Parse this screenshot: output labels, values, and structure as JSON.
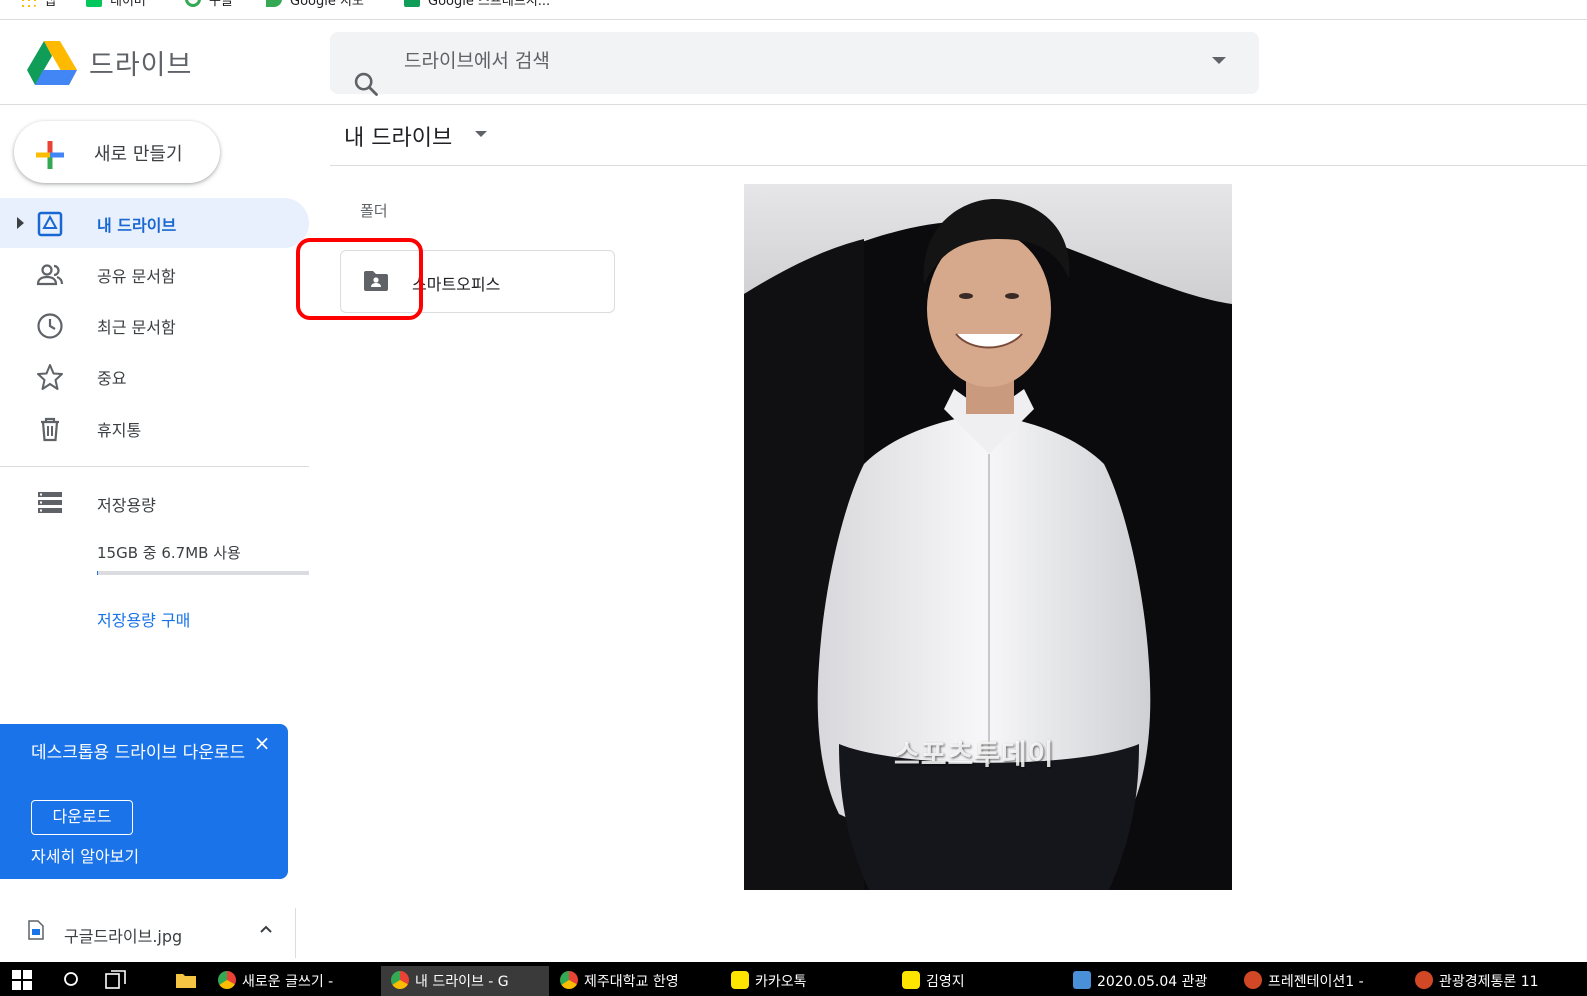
{
  "bookmarks": [
    {
      "label": "앱",
      "color": "#fbbc04"
    },
    {
      "label": "네이버",
      "color": "#03c75a"
    },
    {
      "label": "구글",
      "color": "#34a853"
    },
    {
      "label": "Google 지도",
      "color": "#34a853"
    },
    {
      "label": "Google 스프레드시...",
      "color": "#0f9d58"
    }
  ],
  "header": {
    "app_title": "드라이브",
    "search_placeholder": "드라이브에서 검색"
  },
  "new_button": {
    "label": "새로 만들기"
  },
  "sidebar": {
    "items": [
      {
        "label": "내 드라이브",
        "icon": "my-drive-icon",
        "active": true
      },
      {
        "label": "공유 문서함",
        "icon": "shared-people-icon"
      },
      {
        "label": "최근 문서함",
        "icon": "clock-icon"
      },
      {
        "label": "중요",
        "icon": "star-icon"
      },
      {
        "label": "휴지통",
        "icon": "trash-icon"
      }
    ],
    "storage": {
      "label": "저장용량",
      "usage": "15GB 중 6.7MB 사용",
      "used_fraction": 0.0005,
      "buy_label": "저장용량 구매"
    }
  },
  "main": {
    "breadcrumb": "내 드라이브",
    "folders_heading": "폴더",
    "folders": [
      {
        "name": "스마트오피스"
      }
    ]
  },
  "photo": {
    "watermark": "스포츠투데이"
  },
  "promo": {
    "title": "데스크톱용 드라이브 다운로드",
    "download_label": "다운로드",
    "learn_more": "자세히 알아보기",
    "close": "×"
  },
  "downloads": {
    "file_name": "구글드라이브.jpg"
  },
  "taskbar": {
    "items": [
      {
        "label": "새로운 글쓰기 -",
        "icon": "chrome-icon"
      },
      {
        "label": "내 드라이브 - G",
        "icon": "chrome-icon",
        "active": true
      },
      {
        "label": "제주대학교 한영",
        "icon": "chrome-icon"
      },
      {
        "label": "카카오톡",
        "icon": "kakaotalk-icon"
      },
      {
        "label": "김영지",
        "icon": "kakaotalk-icon"
      },
      {
        "label": "2020.05.04 관광",
        "icon": "document-icon"
      },
      {
        "label": "프레젠테이션1 -",
        "icon": "powerpoint-icon"
      },
      {
        "label": "관광경제통론 11",
        "icon": "powerpoint-icon"
      }
    ]
  },
  "colors": {
    "accent": "#1a73e8",
    "active_nav_bg": "#e8f0fe",
    "highlight": "#ff0000"
  }
}
